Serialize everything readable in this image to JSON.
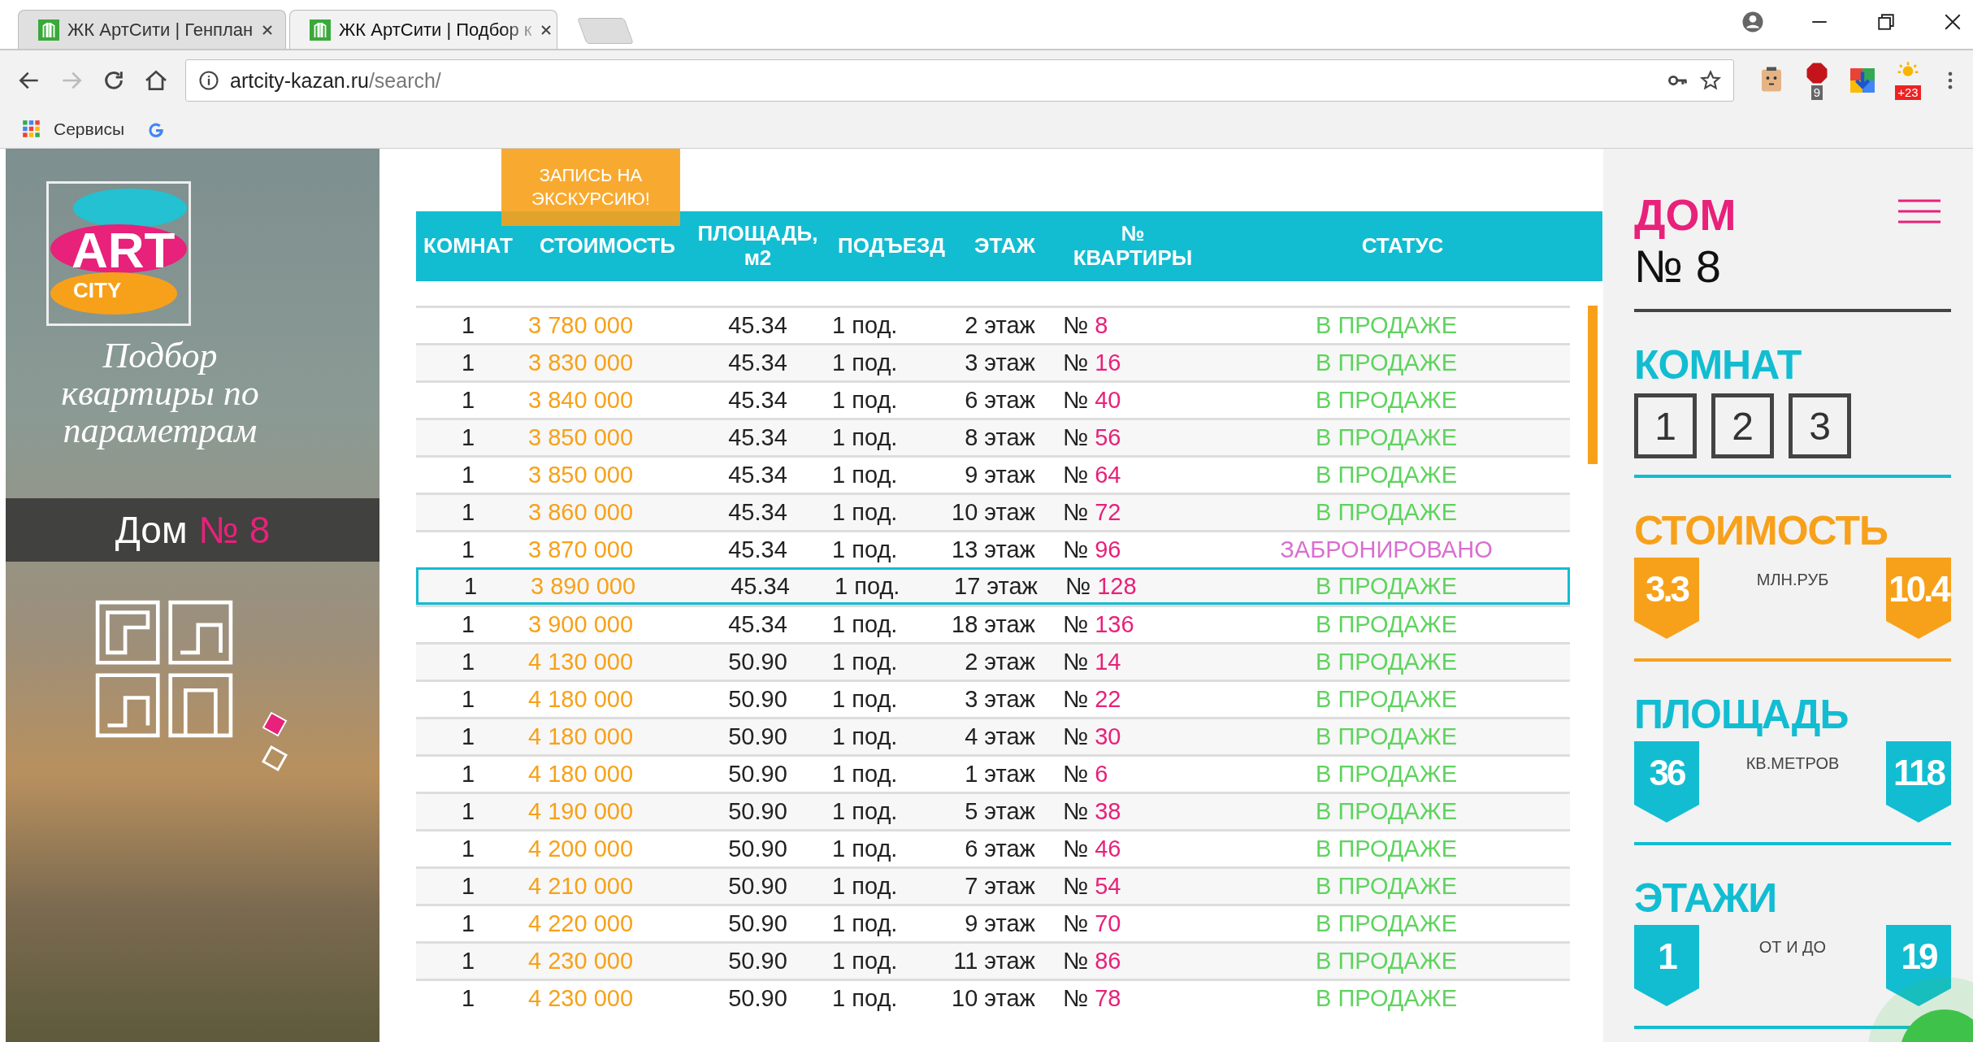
{
  "browser": {
    "tabs": [
      {
        "title": "ЖК АртСити | Генплан",
        "selected": false
      },
      {
        "title": "ЖК АртСити | Подбор к",
        "selected": true
      }
    ],
    "address": {
      "host": "artcity-kazan.ru",
      "path": "/search/"
    },
    "extensions": [
      {
        "kind": "face"
      },
      {
        "kind": "adblock",
        "badge": "9"
      },
      {
        "kind": "arrow"
      },
      {
        "kind": "weather",
        "badge": "+23"
      }
    ],
    "bookmarks": [
      {
        "kind": "apps",
        "label": "Сервисы"
      },
      {
        "kind": "google"
      }
    ]
  },
  "sidebar": {
    "logo": {
      "art": "ART",
      "city": "CITY"
    },
    "tagline": "Подбор квартиры по параметрам",
    "house": {
      "label": "Дом",
      "number": "№ 8"
    }
  },
  "excursion_button": "ЗАПИСЬ НА ЭКСКУРСИЮ!",
  "table": {
    "columns": [
      "КОМНАТ",
      "СТОИМОСТЬ",
      "ПЛОЩАДЬ, м2",
      "ПОДЪЕЗД",
      "ЭТАЖ",
      "№ КВАРТИРЫ",
      "СТАТУС"
    ],
    "rows": [
      {
        "rooms": "1",
        "price": "3 780 000",
        "area": "45.34",
        "entrance": "1 под.",
        "floor": "2 этаж",
        "apt_sign": "№",
        "apt": "8",
        "status": "В ПРОДАЖЕ",
        "kind": "sale",
        "selected": false
      },
      {
        "rooms": "1",
        "price": "3 830 000",
        "area": "45.34",
        "entrance": "1 под.",
        "floor": "3 этаж",
        "apt_sign": "№",
        "apt": "16",
        "status": "В ПРОДАЖЕ",
        "kind": "sale",
        "selected": false
      },
      {
        "rooms": "1",
        "price": "3 840 000",
        "area": "45.34",
        "entrance": "1 под.",
        "floor": "6 этаж",
        "apt_sign": "№",
        "apt": "40",
        "status": "В ПРОДАЖЕ",
        "kind": "sale",
        "selected": false
      },
      {
        "rooms": "1",
        "price": "3 850 000",
        "area": "45.34",
        "entrance": "1 под.",
        "floor": "8 этаж",
        "apt_sign": "№",
        "apt": "56",
        "status": "В ПРОДАЖЕ",
        "kind": "sale",
        "selected": false
      },
      {
        "rooms": "1",
        "price": "3 850 000",
        "area": "45.34",
        "entrance": "1 под.",
        "floor": "9 этаж",
        "apt_sign": "№",
        "apt": "64",
        "status": "В ПРОДАЖЕ",
        "kind": "sale",
        "selected": false
      },
      {
        "rooms": "1",
        "price": "3 860 000",
        "area": "45.34",
        "entrance": "1 под.",
        "floor": "10 этаж",
        "apt_sign": "№",
        "apt": "72",
        "status": "В ПРОДАЖЕ",
        "kind": "sale",
        "selected": false
      },
      {
        "rooms": "1",
        "price": "3 870 000",
        "area": "45.34",
        "entrance": "1 под.",
        "floor": "13 этаж",
        "apt_sign": "№",
        "apt": "96",
        "status": "ЗАБРОНИРОВАНО",
        "kind": "reserved",
        "selected": false
      },
      {
        "rooms": "1",
        "price": "3 890 000",
        "area": "45.34",
        "entrance": "1 под.",
        "floor": "17 этаж",
        "apt_sign": "№",
        "apt": "128",
        "status": "В ПРОДАЖЕ",
        "kind": "sale",
        "selected": true
      },
      {
        "rooms": "1",
        "price": "3 900 000",
        "area": "45.34",
        "entrance": "1 под.",
        "floor": "18 этаж",
        "apt_sign": "№",
        "apt": "136",
        "status": "В ПРОДАЖЕ",
        "kind": "sale",
        "selected": false
      },
      {
        "rooms": "1",
        "price": "4 130 000",
        "area": "50.90",
        "entrance": "1 под.",
        "floor": "2 этаж",
        "apt_sign": "№",
        "apt": "14",
        "status": "В ПРОДАЖЕ",
        "kind": "sale",
        "selected": false
      },
      {
        "rooms": "1",
        "price": "4 180 000",
        "area": "50.90",
        "entrance": "1 под.",
        "floor": "3 этаж",
        "apt_sign": "№",
        "apt": "22",
        "status": "В ПРОДАЖЕ",
        "kind": "sale",
        "selected": false
      },
      {
        "rooms": "1",
        "price": "4 180 000",
        "area": "50.90",
        "entrance": "1 под.",
        "floor": "4 этаж",
        "apt_sign": "№",
        "apt": "30",
        "status": "В ПРОДАЖЕ",
        "kind": "sale",
        "selected": false
      },
      {
        "rooms": "1",
        "price": "4 180 000",
        "area": "50.90",
        "entrance": "1 под.",
        "floor": "1 этаж",
        "apt_sign": "№",
        "apt": "6",
        "status": "В ПРОДАЖЕ",
        "kind": "sale",
        "selected": false
      },
      {
        "rooms": "1",
        "price": "4 190 000",
        "area": "50.90",
        "entrance": "1 под.",
        "floor": "5 этаж",
        "apt_sign": "№",
        "apt": "38",
        "status": "В ПРОДАЖЕ",
        "kind": "sale",
        "selected": false
      },
      {
        "rooms": "1",
        "price": "4 200 000",
        "area": "50.90",
        "entrance": "1 под.",
        "floor": "6 этаж",
        "apt_sign": "№",
        "apt": "46",
        "status": "В ПРОДАЖЕ",
        "kind": "sale",
        "selected": false
      },
      {
        "rooms": "1",
        "price": "4 210 000",
        "area": "50.90",
        "entrance": "1 под.",
        "floor": "7 этаж",
        "apt_sign": "№",
        "apt": "54",
        "status": "В ПРОДАЖЕ",
        "kind": "sale",
        "selected": false
      },
      {
        "rooms": "1",
        "price": "4 220 000",
        "area": "50.90",
        "entrance": "1 под.",
        "floor": "9 этаж",
        "apt_sign": "№",
        "apt": "70",
        "status": "В ПРОДАЖЕ",
        "kind": "sale",
        "selected": false
      },
      {
        "rooms": "1",
        "price": "4 230 000",
        "area": "50.90",
        "entrance": "1 под.",
        "floor": "11 этаж",
        "apt_sign": "№",
        "apt": "86",
        "status": "В ПРОДАЖЕ",
        "kind": "sale",
        "selected": false
      },
      {
        "rooms": "1",
        "price": "4 230 000",
        "area": "50.90",
        "entrance": "1 под.",
        "floor": "10 этаж",
        "apt_sign": "№",
        "apt": "78",
        "status": "В ПРОДАЖЕ",
        "kind": "sale",
        "selected": false
      }
    ]
  },
  "filters": {
    "house": {
      "label": "ДОМ",
      "number": "№ 8"
    },
    "rooms": {
      "label": "КОМНАТ",
      "options": [
        "1",
        "2",
        "3"
      ]
    },
    "ranges": [
      {
        "label": "СТОИМОСТЬ",
        "min": "3.3",
        "max": "10.4",
        "unit": "МЛН.РУБ",
        "color": "#f7a11a"
      },
      {
        "label": "ПЛОЩАДЬ",
        "min": "36",
        "max": "118",
        "unit": "КВ.МЕТРОВ",
        "color": "#12bdd2"
      },
      {
        "label": "ЭТАЖИ",
        "min": "1",
        "max": "19",
        "unit": "ОТ И ДО",
        "color": "#12bdd2"
      }
    ]
  }
}
